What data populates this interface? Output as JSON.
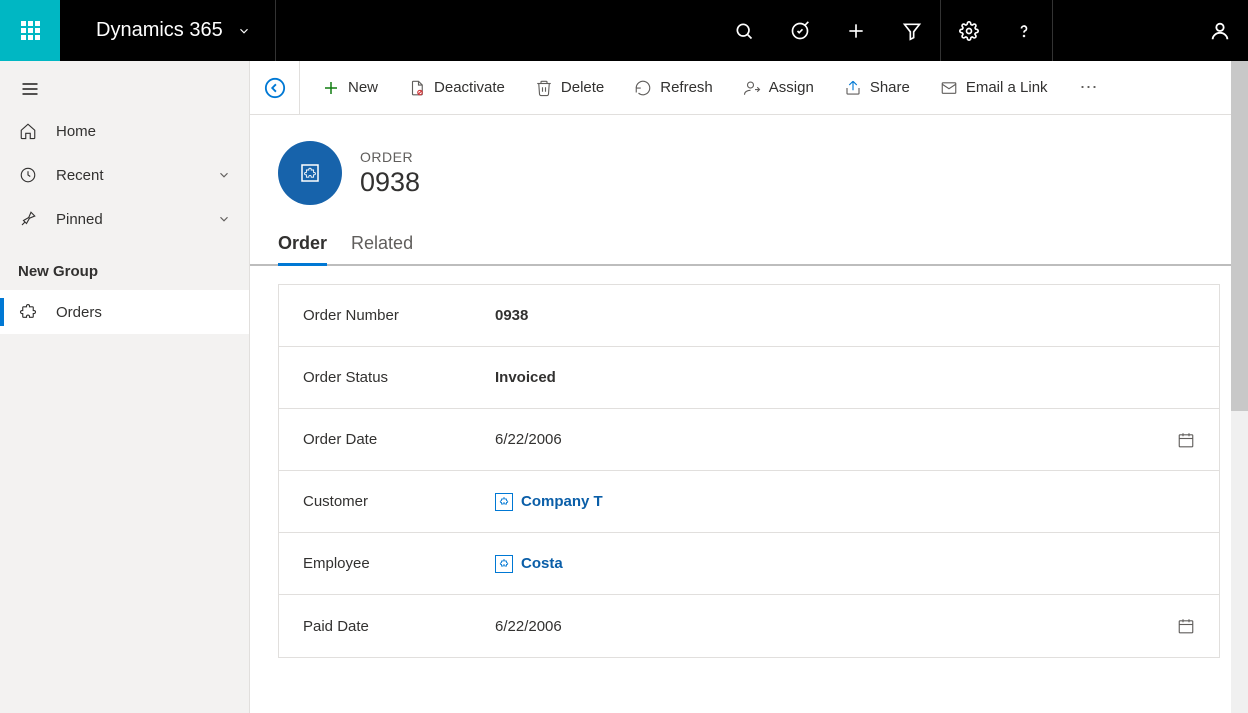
{
  "header": {
    "app_name": "Dynamics 365"
  },
  "sidebar": {
    "items": [
      {
        "label": "Home"
      },
      {
        "label": "Recent"
      },
      {
        "label": "Pinned"
      }
    ],
    "group_header": "New Group",
    "group_items": [
      {
        "label": "Orders"
      }
    ]
  },
  "commands": {
    "new": "New",
    "deactivate": "Deactivate",
    "delete": "Delete",
    "refresh": "Refresh",
    "assign": "Assign",
    "share": "Share",
    "email_link": "Email a Link"
  },
  "record": {
    "entity_label": "ORDER",
    "title": "0938"
  },
  "tabs": {
    "order": "Order",
    "related": "Related"
  },
  "form": {
    "fields": [
      {
        "label": "Order Number",
        "value": "0938"
      },
      {
        "label": "Order Status",
        "value": "Invoiced"
      },
      {
        "label": "Order Date",
        "value": "6/22/2006"
      },
      {
        "label": "Customer",
        "value": "Company T"
      },
      {
        "label": "Employee",
        "value": "Costa"
      },
      {
        "label": "Paid Date",
        "value": "6/22/2006"
      }
    ]
  }
}
